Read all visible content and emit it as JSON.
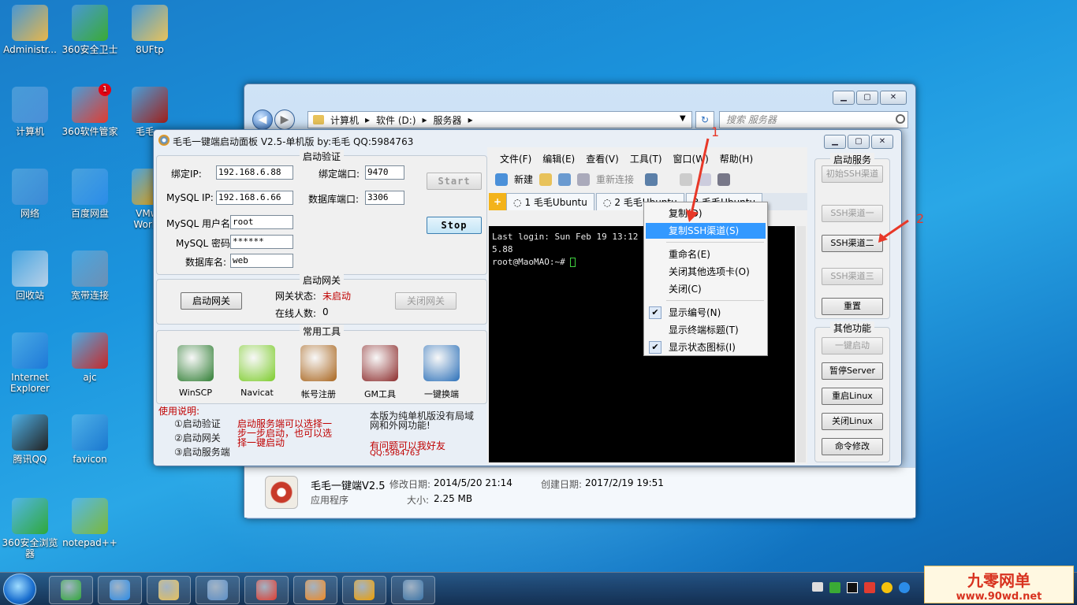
{
  "desktop": {
    "icons": [
      {
        "label": "Administr...",
        "icon": "user-folder-icon",
        "color": "#e8b64a"
      },
      {
        "label": "360安全卫士",
        "icon": "360-security-icon",
        "color": "#3aaa35"
      },
      {
        "label": "8UFtp",
        "icon": "folder-icon",
        "color": "#e8c25a"
      },
      {
        "label": "计算机",
        "icon": "computer-icon",
        "color": "#4a8fd8"
      },
      {
        "label": "360软件管家",
        "icon": "360-software-icon",
        "color": "#e03c31",
        "badge": "1"
      },
      {
        "label": "毛毛一",
        "icon": "game-dragon-icon",
        "color": "#a0201a"
      },
      {
        "label": "网络",
        "icon": "network-icon",
        "color": "#3c8ad6"
      },
      {
        "label": "百度网盘",
        "icon": "baidu-cloud-icon",
        "color": "#2b8ce8"
      },
      {
        "label": "VMwa Workst",
        "icon": "vmware-icon",
        "color": "#f0a000"
      },
      {
        "label": "回收站",
        "icon": "recycle-bin-icon",
        "color": "#b8d0e8"
      },
      {
        "label": "宽带连接",
        "icon": "broadband-icon",
        "color": "#6c8fb4"
      },
      {
        "label": "Internet Explorer",
        "icon": "ie-icon",
        "color": "#1e79d8"
      },
      {
        "label": "ajc",
        "icon": "jpeg-file-icon",
        "color": "#c82828"
      },
      {
        "label": "腾讯QQ",
        "icon": "qq-icon",
        "color": "#222222"
      },
      {
        "label": "favicon",
        "icon": "favicon-file-icon",
        "color": "#1a78d0"
      },
      {
        "label": "360安全浏览器",
        "icon": "360-browser-icon",
        "color": "#2fa83a"
      },
      {
        "label": "notepad++",
        "icon": "notepad-icon",
        "color": "#7cb83a"
      }
    ]
  },
  "explorer": {
    "breadcrumb": [
      "计算机",
      "软件 (D:)",
      "服务器"
    ],
    "search_placeholder": "搜索 服务器",
    "nav_back": "◀",
    "nav_forward": "▶",
    "refresh": "↻",
    "details": {
      "name": "毛毛一键端V2.5",
      "type": "应用程序",
      "modified_label": "修改日期:",
      "modified": "2014/5/20 21:14",
      "size_label": "大小:",
      "size": "2.25 MB",
      "created_label": "创建日期:",
      "created": "2017/2/19 19:51"
    }
  },
  "panel": {
    "title": "毛毛一键端启动面板 V2.5-单机版 by:毛毛  QQ:5984763",
    "auth": {
      "group_title": "启动验证",
      "bind_ip_label": "绑定IP:",
      "bind_ip": "192.168.6.88",
      "bind_port_label": "绑定端口:",
      "bind_port": "9470",
      "mysql_ip_label": "MySQL IP:",
      "mysql_ip": "192.168.6.66",
      "db_port_label": "数据库端口:",
      "db_port": "3306",
      "mysql_user_label": "MySQL 用户名:",
      "mysql_user": "root",
      "mysql_pass_label": "MySQL 密码:",
      "mysql_pass": "******",
      "db_name_label": "数据库名:",
      "db_name": "web",
      "start_label": "Start",
      "stop_label": "Stop"
    },
    "gateway": {
      "group_title": "启动网关",
      "start_label": "启动网关",
      "status_label": "网关状态:",
      "status_value": "未启动",
      "online_label": "在线人数:",
      "online_value": "0",
      "close_label": "关闭网关"
    },
    "tools": {
      "group_title": "常用工具",
      "items": [
        {
          "label": "WinSCP",
          "icon": "winscp-icon",
          "color": "#2e7d32"
        },
        {
          "label": "Navicat",
          "icon": "navicat-icon",
          "color": "#7ccc2a"
        },
        {
          "label": "帐号注册",
          "icon": "account-register-icon",
          "color": "#a8641c"
        },
        {
          "label": "GM工具",
          "icon": "gm-tool-icon",
          "color": "#8b2a2a"
        },
        {
          "label": "一键换端",
          "icon": "switch-tool-icon",
          "color": "#2a6fb8"
        }
      ]
    },
    "usage": {
      "title": "使用说明:",
      "steps": [
        "①启动验证",
        "②启动网关",
        "③启动服务端"
      ],
      "note_line1": "启动服务端可以选择一",
      "note_line2": "步一步启动，也可以选",
      "note_line3": "择一键启动",
      "info_line1": "本版为纯单机版没有局域",
      "info_line2": "网和外网功能!",
      "contact": "有问题可以我好友",
      "qq": "QQ:5984763"
    },
    "terminal": {
      "menu": [
        "文件(F)",
        "编辑(E)",
        "查看(V)",
        "工具(T)",
        "窗口(W)",
        "帮助(H)"
      ],
      "toolbar_new": "新建",
      "toolbar_reconnect": "重新连接",
      "tabs": [
        "1 毛毛Ubuntu",
        "2 毛毛Ubuntu",
        "3 毛毛Ubuntu"
      ],
      "line1": "Last login: Sun Feb 19 13:12",
      "line1_tail": "5.88",
      "prompt": "root@MaoMAO:~# "
    },
    "context_menu": {
      "items": [
        {
          "label": "复制(D)",
          "selected": false,
          "checked": false
        },
        {
          "label": "复制SSH渠道(S)",
          "selected": true,
          "checked": false
        },
        {
          "label": "重命名(E)",
          "selected": false,
          "checked": false
        },
        {
          "label": "关闭其他选项卡(O)",
          "selected": false,
          "checked": false
        },
        {
          "label": "关闭(C)",
          "selected": false,
          "checked": false
        },
        {
          "label": "显示编号(N)",
          "selected": false,
          "checked": true
        },
        {
          "label": "显示终端标题(T)",
          "selected": false,
          "checked": false
        },
        {
          "label": "显示状态图标(I)",
          "selected": false,
          "checked": true
        }
      ]
    },
    "services": {
      "group_title": "启动服务",
      "buttons": [
        {
          "label": "初始SSH渠道",
          "enabled": false
        },
        {
          "label": "SSH渠道一",
          "enabled": false
        },
        {
          "label": "SSH渠道二",
          "enabled": true
        },
        {
          "label": "SSH渠道三",
          "enabled": false
        },
        {
          "label": "重置",
          "enabled": true
        }
      ],
      "other_title": "其他功能",
      "other_buttons": [
        {
          "label": "一键启动",
          "enabled": false
        },
        {
          "label": "暂停Server",
          "enabled": true
        },
        {
          "label": "重启Linux",
          "enabled": true
        },
        {
          "label": "关闭Linux",
          "enabled": true
        },
        {
          "label": "命令修改",
          "enabled": true
        }
      ]
    }
  },
  "annotations": {
    "one": "1",
    "two": "2"
  },
  "taskbar": {
    "apps": [
      {
        "icon": "360-browser-icon",
        "color": "#2fa83a"
      },
      {
        "icon": "baidu-cloud-icon",
        "color": "#2b8ce8"
      },
      {
        "icon": "file-explorer-icon",
        "color": "#e8c25a"
      },
      {
        "icon": "remote-desktop-icon",
        "color": "#5b8fc8"
      },
      {
        "icon": "360-software-icon",
        "color": "#e03c31"
      },
      {
        "icon": "media-player-icon",
        "color": "#f08a24"
      },
      {
        "icon": "vmware-icon",
        "color": "#f0a000"
      },
      {
        "icon": "python-icon",
        "color": "#3a74a8"
      }
    ]
  },
  "watermark": {
    "title": "九零网单",
    "url": "www.90wd.net"
  }
}
